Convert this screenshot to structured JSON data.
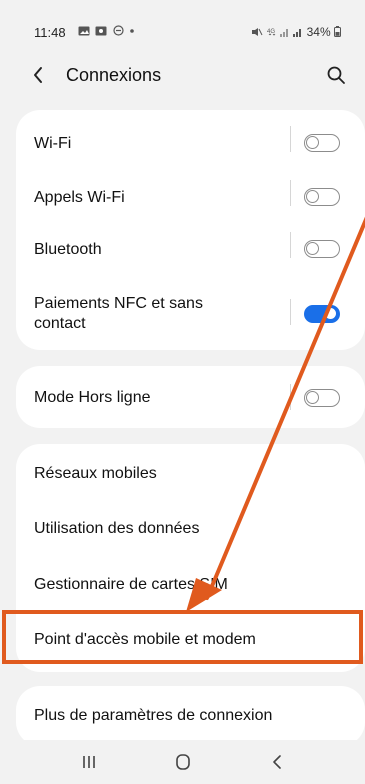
{
  "status_bar": {
    "time": "11:48",
    "left_icons": [
      "gallery-notification-icon",
      "photo-notification-icon",
      "do-not-disturb-icon",
      "dot-icon"
    ],
    "battery": "34%",
    "right_icons": [
      "mute-icon",
      "data-4g-icon",
      "signal-icon",
      "signal-icon",
      "battery-icon"
    ]
  },
  "header": {
    "title": "Connexions",
    "back_icon": "chevron-left-icon",
    "search_icon": "search-icon"
  },
  "group1": [
    {
      "label": "Wi-Fi",
      "toggle": "off"
    },
    {
      "label": "Appels Wi-Fi",
      "toggle": "off"
    },
    {
      "label": "Bluetooth",
      "toggle": "off"
    },
    {
      "label_line1": "Paiements NFC et sans",
      "label_line2": "contact",
      "toggle": "on"
    }
  ],
  "group2": [
    {
      "label": "Mode Hors ligne",
      "toggle": "off"
    }
  ],
  "group3": [
    {
      "label": "Réseaux mobiles"
    },
    {
      "label": "Utilisation des données"
    },
    {
      "label": "Gestionnaire de cartes SIM"
    },
    {
      "label": "Point d'accès mobile et modem"
    }
  ],
  "group4": [
    {
      "label": "Plus de paramètres de connexion"
    }
  ],
  "annotation": {
    "color": "#e05a1e",
    "target": "Point d'accès mobile et modem"
  },
  "nav_bar": {
    "icons": [
      "recent-apps-icon",
      "home-icon",
      "back-icon"
    ]
  },
  "colors": {
    "background": "#f2f2f2",
    "card": "#ffffff",
    "toggle_on": "#1a6fe8",
    "annotation": "#e05a1e"
  }
}
